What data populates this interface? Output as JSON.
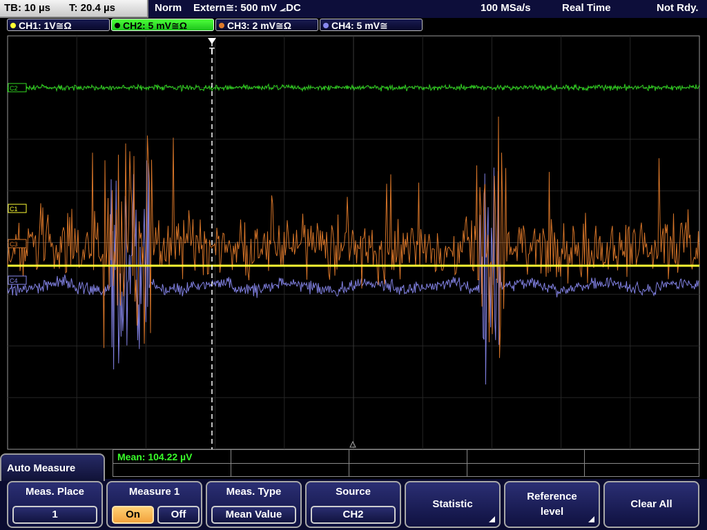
{
  "status": {
    "timebase": "TB: 10 µs",
    "trigger_time": "T: 20.4 µs",
    "trigger_mode": "Norm",
    "trigger_source": "Extern≅: 500 mV ⦟DC",
    "sample_rate": "100 MSa/s",
    "acq_mode": "Real Time",
    "run_state": "Not Rdy."
  },
  "channels": [
    {
      "label": "CH1: 1V≅Ω",
      "color": "#ffff33",
      "active": false,
      "marker": "C1"
    },
    {
      "label": "CH2: 5 mV≅Ω",
      "color": "#33dd22",
      "active": true,
      "marker": "C2"
    },
    {
      "label": "CH3: 2 mV≅Ω",
      "color": "#e07a2a",
      "active": false,
      "marker": "C3"
    },
    {
      "label": "CH4: 5 mV≅",
      "color": "#8888ee",
      "active": false,
      "marker": "C4"
    }
  ],
  "trigger_marker": "T",
  "measurement": {
    "result": "Mean: 104.22 µV"
  },
  "menu": {
    "title": "Auto Measure",
    "meas_place": {
      "label": "Meas. Place",
      "value": "1"
    },
    "measure1": {
      "label": "Measure 1",
      "on": "On",
      "off": "Off",
      "selected": "On"
    },
    "meas_type": {
      "label": "Meas. Type",
      "value": "Mean Value"
    },
    "source": {
      "label": "Source",
      "value": "CH2"
    },
    "statistic": "Statistic",
    "reference_level": [
      "Reference",
      "level"
    ],
    "clear_all": "Clear All"
  }
}
